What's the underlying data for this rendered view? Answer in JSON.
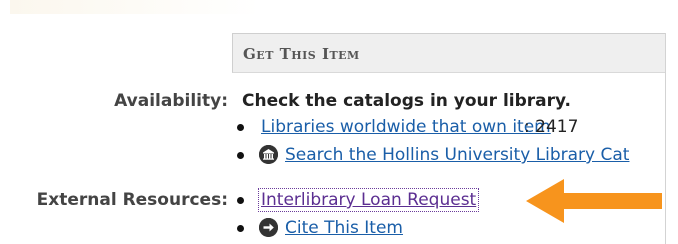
{
  "section": {
    "header": "Get This Item"
  },
  "availability": {
    "label": "Availability:",
    "text": "Check the catalogs in your library."
  },
  "availability_links": [
    {
      "label": "Libraries worldwide that own item",
      "suffix": ": 2417"
    },
    {
      "label": "Search the Hollins University Library Cat"
    }
  ],
  "external_resources": {
    "label": "External Resources:",
    "links": [
      {
        "label": "Interlibrary Loan Request"
      },
      {
        "label": "Cite This Item"
      }
    ]
  },
  "icons": {
    "library": "library-icon",
    "cite": "cite-icon",
    "pointer_arrow": "arrow-left-icon"
  },
  "colors": {
    "link": "#1a5ea8",
    "visited_link": "#5b2e91",
    "arrow": "#f7941d"
  }
}
